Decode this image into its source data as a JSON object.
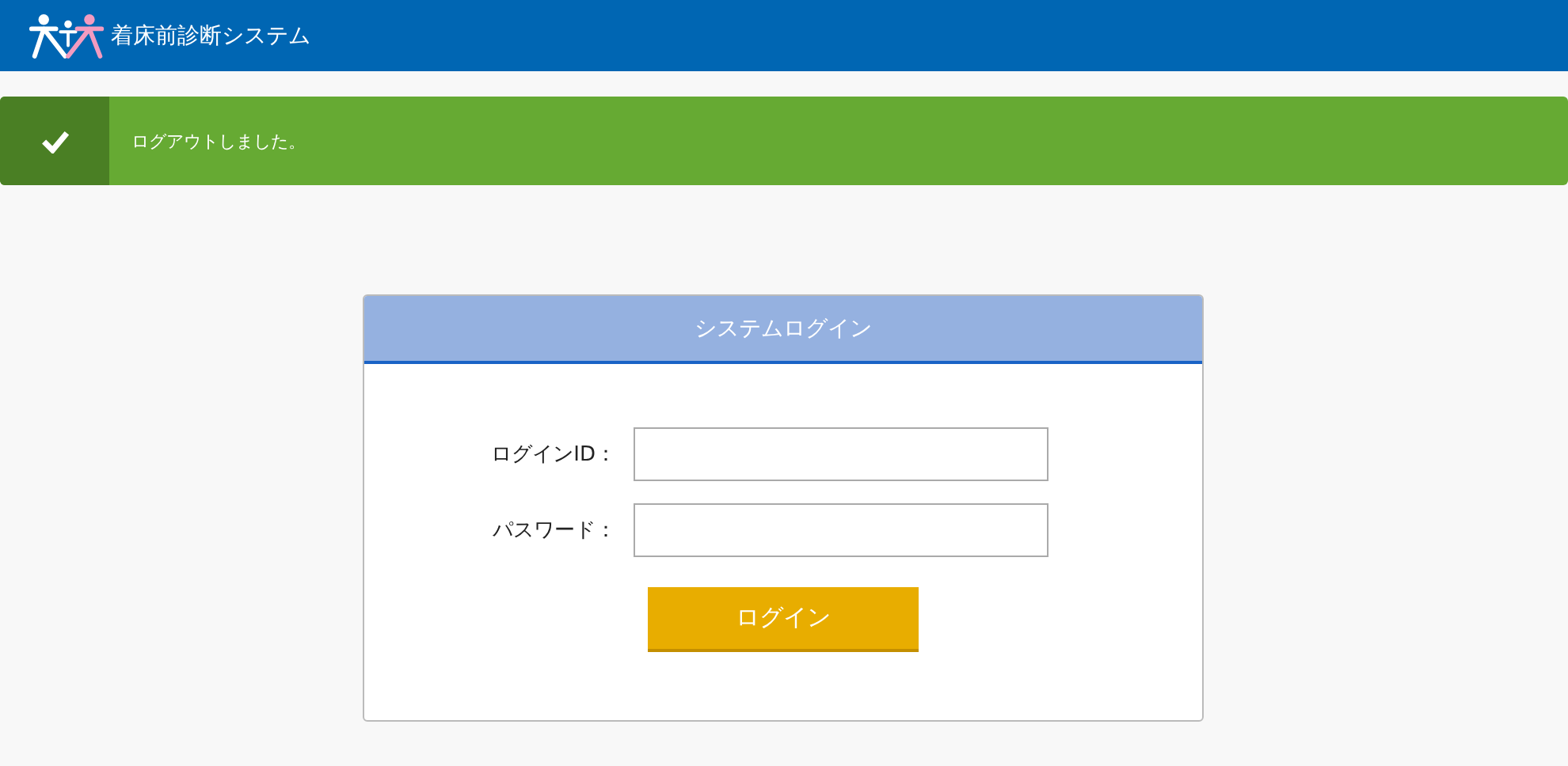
{
  "header": {
    "title": "着床前診断システム"
  },
  "alert": {
    "kind": "success",
    "message": "ログアウトしました。"
  },
  "login": {
    "title": "システムログイン",
    "fields": [
      {
        "label": "ログインID："
      },
      {
        "label": "パスワード："
      }
    ],
    "button": "ログイン"
  }
}
